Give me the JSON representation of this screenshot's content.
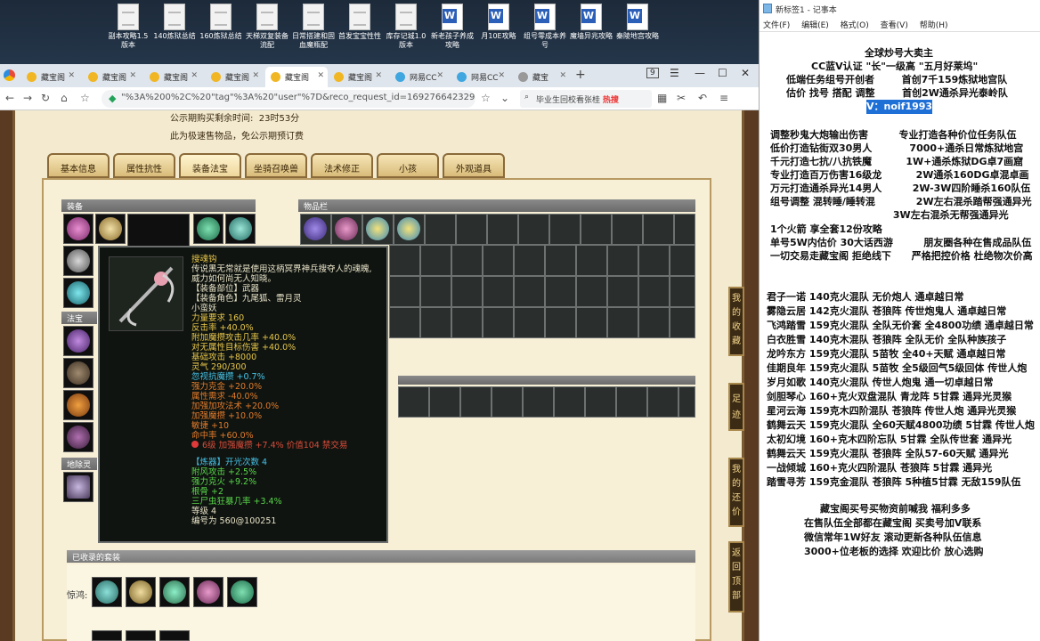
{
  "desktop": {
    "icons": [
      {
        "label": "副本攻略1.5版本",
        "type": "doc"
      },
      {
        "label": "140炼狱总结",
        "type": "doc"
      },
      {
        "label": "160炼狱总结",
        "type": "doc"
      },
      {
        "label": "天梯双复装备流配",
        "type": "doc"
      },
      {
        "label": "日常搭建和固血魔瓶配",
        "type": "doc"
      },
      {
        "label": "首发宝宝性性",
        "type": "doc"
      },
      {
        "label": "库存记城1.0版本",
        "type": "doc"
      },
      {
        "label": "新老孩子养成攻略",
        "type": "word"
      },
      {
        "label": "月10E攻略",
        "type": "word"
      },
      {
        "label": "组号零成本养号",
        "type": "word"
      },
      {
        "label": "魔墙异兆攻略",
        "type": "word"
      },
      {
        "label": "秦陵地宫攻略",
        "type": "word"
      }
    ]
  },
  "browser": {
    "tabs": [
      {
        "label": "藏宝阁"
      },
      {
        "label": "藏宝阁"
      },
      {
        "label": "藏宝阁"
      },
      {
        "label": "藏宝阁"
      },
      {
        "label": "藏宝阁"
      },
      {
        "label": "藏宝阁"
      },
      {
        "label": "网易CC"
      },
      {
        "label": "网易CC"
      },
      {
        "label": "藏宝"
      }
    ],
    "url": "\"%3A%200%2C%20\"tag\"%3A%20\"user\"%7D&reco_request_id=1692766423292ZZAk-",
    "search_text": "毕业生回校看张桂",
    "search_hot": "热搜",
    "badge": "9"
  },
  "game": {
    "remaining_label": "公示期购买剩余时间:",
    "remaining_value": "23时53分",
    "notice": "此为极速售物品，免公示期预订费",
    "tabs": [
      "基本信息",
      "属性抗性",
      "装备法宝",
      "坐骑召唤兽",
      "法术修正",
      "小孩",
      "外观道具"
    ],
    "sections": {
      "equip": "装备",
      "items": "物品栏",
      "fabao": "法宝",
      "lingbao": "地除灵宝",
      "collected_suits": "已收录的套装"
    },
    "suit_label": "惊鸿:",
    "side_buttons": [
      "我的收藏",
      "足迹",
      "我的还价",
      "返回顶部"
    ],
    "colors": {
      "frame": "#7a5a32",
      "panel": "#f7efd6",
      "tip_bg": "#0f1410",
      "tip_text": "#e9d07a"
    }
  },
  "tooltip": {
    "name": "搜魂钩",
    "desc1": "传说黑无常就是使用这柄冥界神兵搜夺人的魂魄,",
    "desc2": "威力如何尚无人知晓。",
    "part": "【装备部位】武器",
    "role": "【装备角色】九尾狐、雷月灵",
    "owner": "小蛮妖",
    "lines": [
      {
        "text": "力量要求 160",
        "color": "c-y"
      },
      {
        "text": "反击率 +40.0%",
        "color": "c-y"
      },
      {
        "text": "附加魔攒攻击几率 +40.0%",
        "color": "c-y"
      },
      {
        "text": "对无属性目标伤害 +40.0%",
        "color": "c-y"
      },
      {
        "text": "基础攻击 +8000",
        "color": "c-y"
      },
      {
        "text": "灵气 290/300",
        "color": "c-y"
      },
      {
        "text": "忽视抗魔攒 +0.7%",
        "color": "c-b"
      },
      {
        "text": "强力克金 +20.0%",
        "color": "c-o"
      },
      {
        "text": "属性需求 -40.0%",
        "color": "c-o"
      },
      {
        "text": "加强加攻法术 +20.0%",
        "color": "c-o"
      },
      {
        "text": "加强魔攒 +10.0%",
        "color": "c-o"
      },
      {
        "text": "敏捷 +10",
        "color": "c-o"
      },
      {
        "text": "命中率 +60.0%",
        "color": "c-o"
      }
    ],
    "gem": "6级 加强魔攒 +7.4% 价值104 禁交易",
    "refine_head": "【炼器】开光次数 4",
    "refine_lines": [
      "附风攻击 +2.5%",
      "强力克火 +9.2%",
      "根骨 +2",
      "三尸虫狂暴几率 +3.4%"
    ],
    "level": "等级 4",
    "serial": "编号为 560@100251"
  },
  "notepad": {
    "title": "新标签1 - 记事本",
    "menu": [
      "文件(F)",
      "编辑(E)",
      "格式(O)",
      "查看(V)",
      "帮助(H)"
    ],
    "header_lines": [
      "全球炒号大卖主",
      "CC蓝V认证 \"长\"一级高 \"五月好莱坞\"",
      "低端任务组号开创者        首创7千159炼狱地宫队",
      "估价 找号 搭配 调整        首创2W通杀异光泰岭队"
    ],
    "contact": "V：noif1993",
    "service_lines": [
      "调整秒鬼大炮输出伤害         专业打造各种价位任务队伍",
      "低价打造钻街双30男人           7000+通杀日常炼狱地宫",
      "千元打造七抗/八抗铁魔          1W+通杀炼狱DG卓7画窟",
      "专业打造百万伤害16级龙          2W通杀160DG卓混卓画",
      "万元打造通杀异光14男人         2W-3W四阶睡杀160队伍",
      "组号调整 混转睡/睡转混            2W左右混杀踏帮强通异光",
      "                                    3W左右混杀无帮强通异光",
      "1个火箭 享全套12份攻略",
      "单号5W内估价 30大话西游         朋友圈各种在售成品队伍",
      "一切交易走藏宝阁 拒绝线下      严格把控价格 杜绝物次价高"
    ],
    "team_lines": [
      "君子一诺 140克火混队 无价炮人 通卓越日常",
      "雾隐云居 142克火混队 苍狼阵 传世炮鬼人 通卓越日常",
      "飞鸿踏雪 159克火混队 全队无价套 全4800功绩 通卓越日常",
      "白衣胜雪 140克木混队 苍狼阵 全队无价 全队种族孩子",
      "龙吟东方 159克火混队 5苗牧 全40+天赋 通卓越日常",
      "佳期良年 159克火混队 5苗牧 全5级回气5级回体 传世人炮",
      "岁月如歌 140克火混队 传世人炮鬼 通一切卓越日常",
      "剑胆琴心 160+克火双盘混队 青龙阵 5甘霖 通异光灵猴",
      "星河云海 159克木四阶混队 苍狼阵 传世人炮 通异光灵猴",
      "鹤舞云天 159克火混队 全60天赋4800功绩 5甘霖 传世人炮",
      "太初幻境 160+克木四阶忘队 5甘霖 全队传世套 通异光",
      "鹤舞云天 159克火混队 苍狼阵 全队57-60天赋 通异光",
      "一战倾城 160+克火四阶混队 苍狼阵 5甘霖 通异光",
      "踏雪寻芳 159克金混队 苍狼阵 5种植5甘霖 无敌159队伍"
    ],
    "footer_lines": [
      "藏宝阁买号买物资前喊我 福利多多",
      "在售队伍全部都在藏宝阁 买卖号加V联系",
      "微信常年1W好友 滚动更新各种队伍信息",
      "3000+位老板的选择 欢迎比价 放心选购"
    ]
  }
}
